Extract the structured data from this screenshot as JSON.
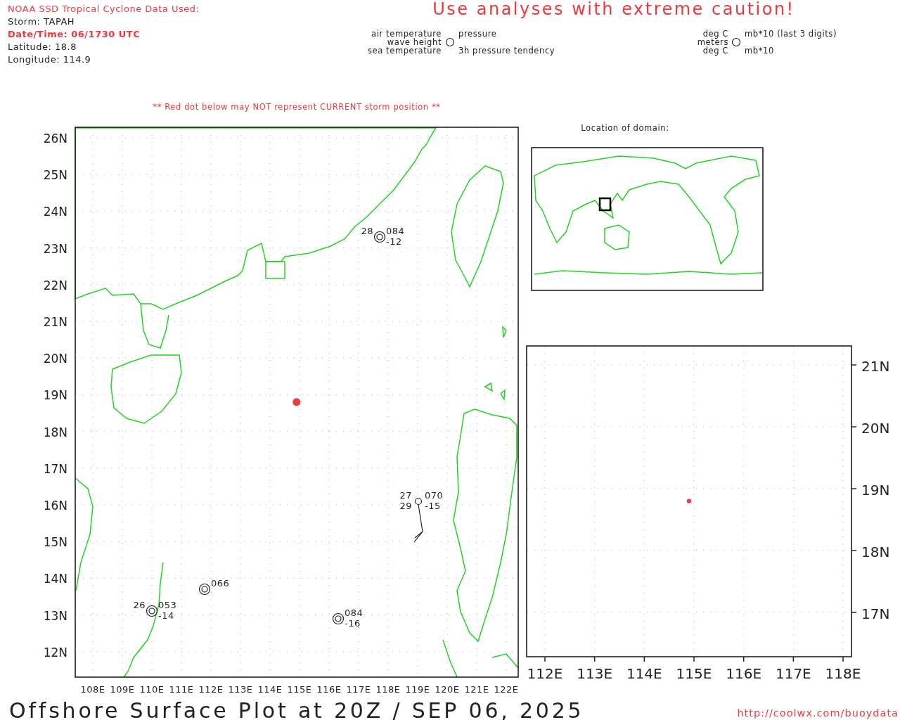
{
  "header": {
    "source": "NOAA SSD Tropical Cyclone Data Used:",
    "storm": "Storm: TAPAH",
    "datetime": "Date/Time: 06/1730 UTC",
    "latitude": {
      "label": "Latitude:",
      "value": "18.8"
    },
    "longitude": {
      "label": "Longitude:",
      "value": "114.9"
    }
  },
  "caution": "Use analyses with extreme caution!",
  "legend": {
    "left_labels": [
      "air temperature",
      "wave height",
      "sea temperature"
    ],
    "right_labels": [
      "pressure",
      "3h pressure tendency"
    ],
    "unit_left_labels": [
      "deg C",
      "meters",
      "deg C"
    ],
    "unit_right_labels": [
      "mb*10 (last 3 digits)",
      "mb*10"
    ]
  },
  "red_dot_note": "** Red dot below may NOT represent CURRENT storm position **",
  "main_map": {
    "lat_labels": [
      "26N",
      "25N",
      "24N",
      "23N",
      "22N",
      "21N",
      "20N",
      "19N",
      "18N",
      "17N",
      "16N",
      "15N",
      "14N",
      "13N",
      "12N"
    ],
    "lon_labels": [
      "108E",
      "109E",
      "110E",
      "111E",
      "112E",
      "113E",
      "114E",
      "115E",
      "116E",
      "117E",
      "118E",
      "119E",
      "120E",
      "121E",
      "122E"
    ],
    "stations": [
      {
        "kind": "ring",
        "air_temp": "28",
        "pressure": "084",
        "tendency": "-12"
      },
      {
        "kind": "barb",
        "air_temp": "27",
        "pressure": "070",
        "sea_temp": "29",
        "tendency": "-15"
      },
      {
        "kind": "ring",
        "pressure": "066"
      },
      {
        "kind": "ring",
        "air_temp": "26",
        "pressure": "053",
        "tendency": "-14"
      },
      {
        "kind": "ring",
        "pressure": "084",
        "tendency": "-16"
      }
    ]
  },
  "inset": {
    "title": "Location of domain:"
  },
  "zoom_map": {
    "lat_labels": [
      "21N",
      "20N",
      "19N",
      "18N",
      "17N"
    ],
    "lon_labels": [
      "112E",
      "113E",
      "114E",
      "115E",
      "116E",
      "117E",
      "118E"
    ]
  },
  "footer": {
    "title": "Offshore Surface Plot at 20Z / SEP 06, 2025",
    "url": "http://coolwx.com/buoydata"
  }
}
